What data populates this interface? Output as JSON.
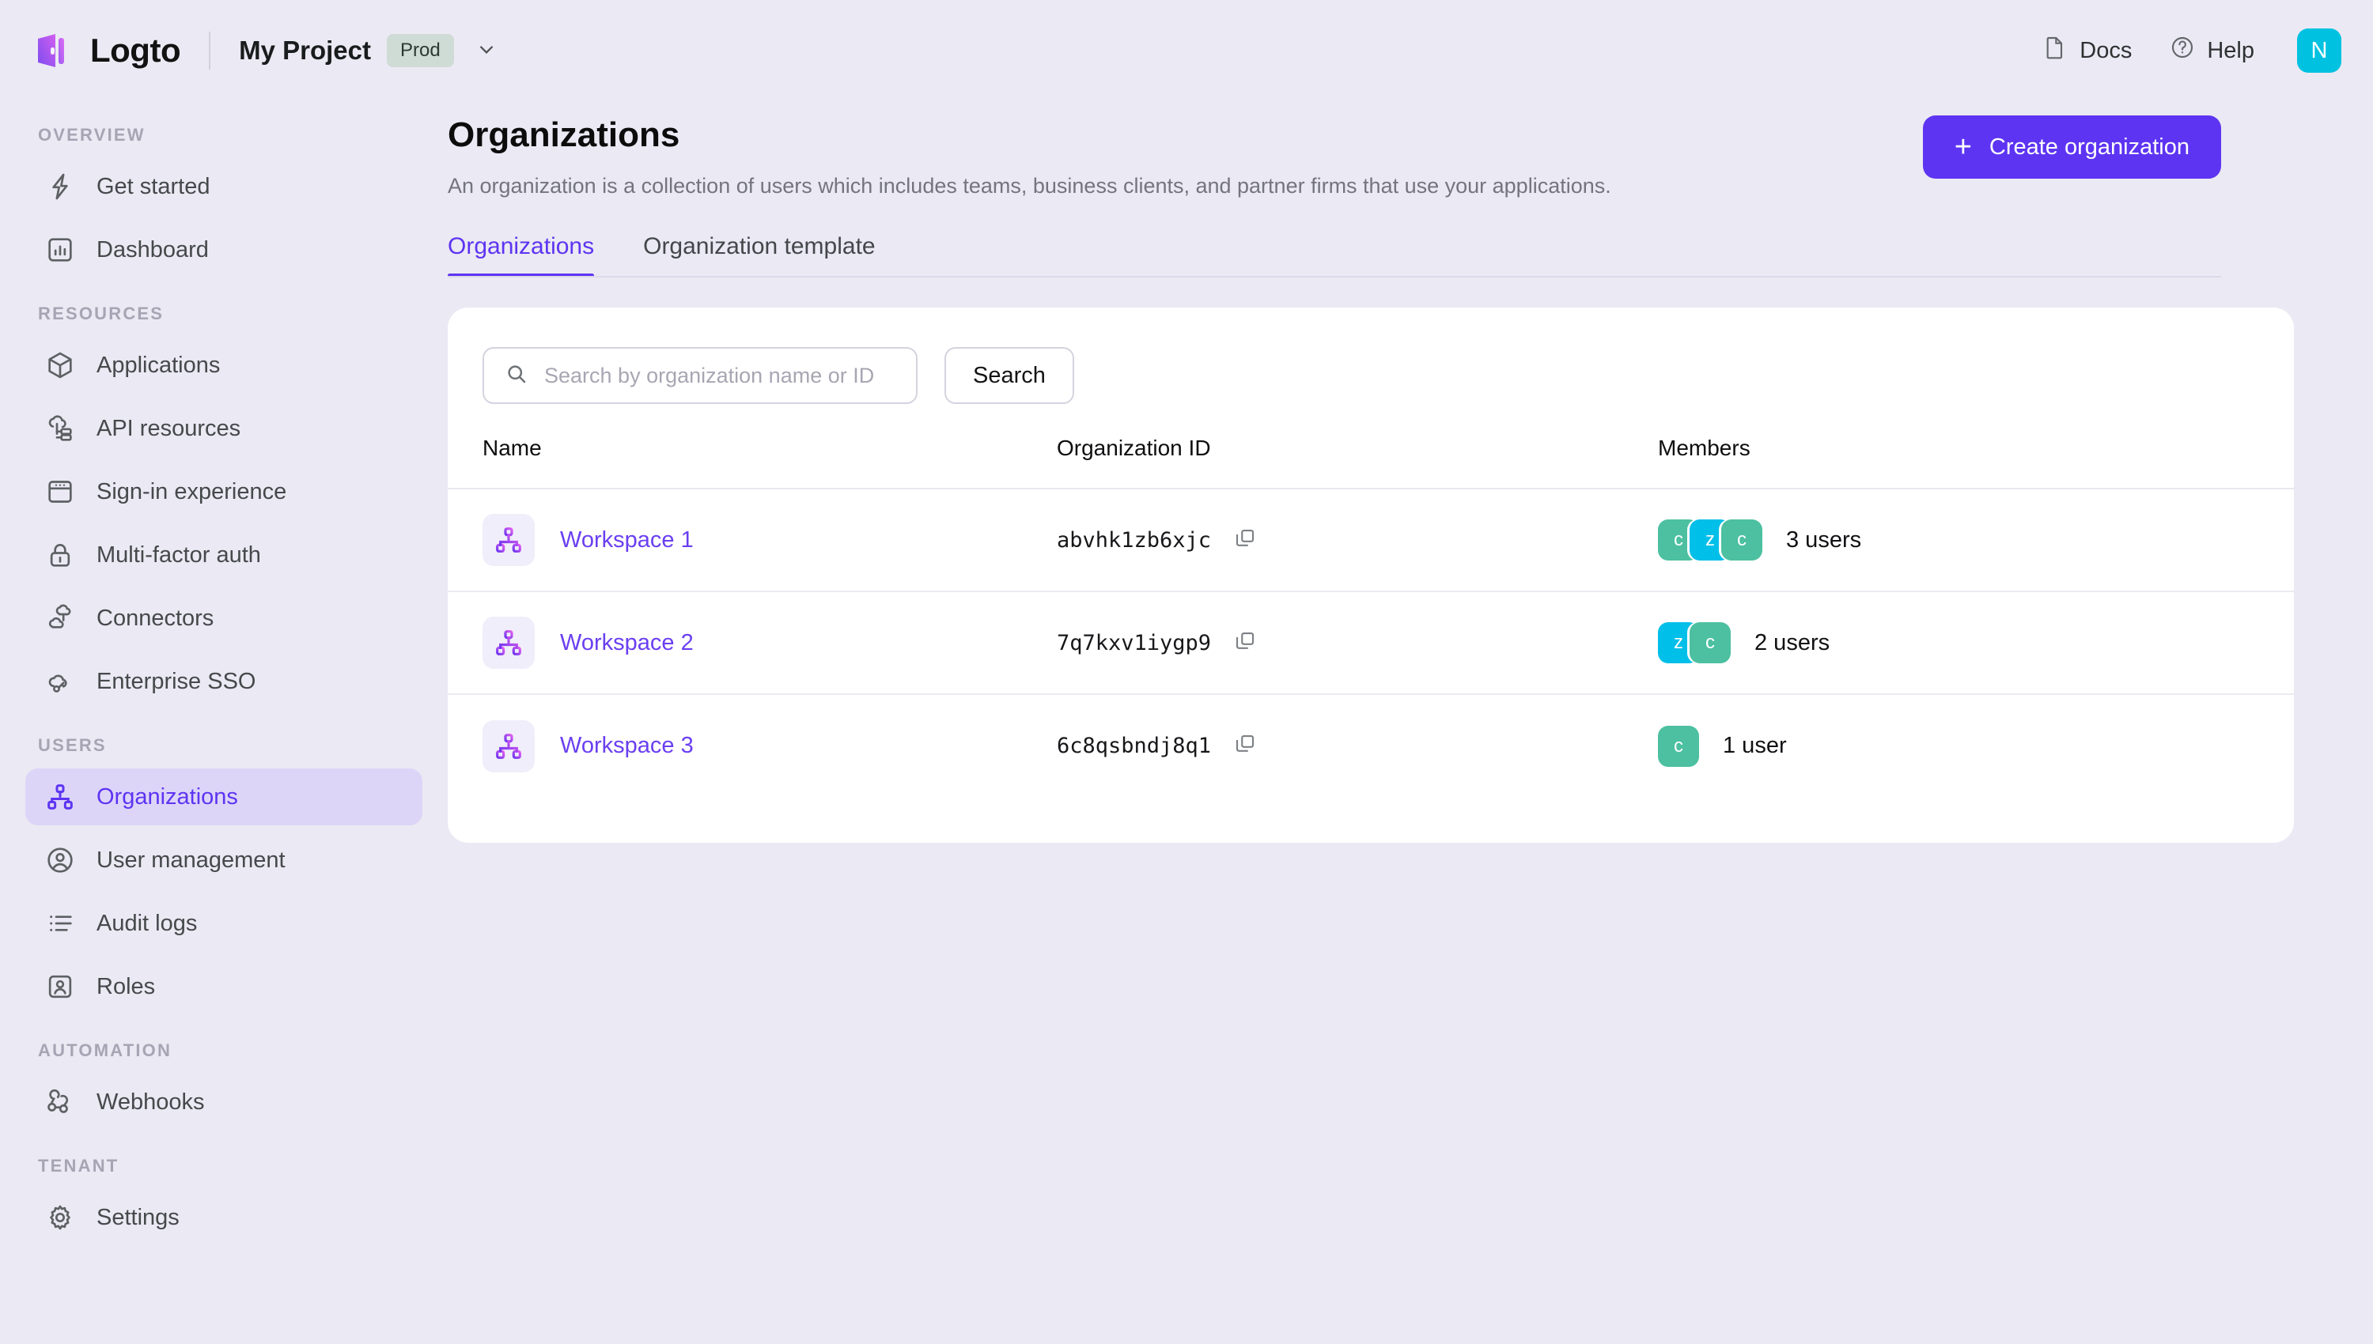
{
  "brand": {
    "name": "Logto",
    "logo_icon": "logto-logo-icon"
  },
  "project": {
    "name": "My Project",
    "badge": "Prod",
    "chevron_icon": "chevron-down-icon"
  },
  "topbar": {
    "docs_label": "Docs",
    "docs_icon": "document-icon",
    "help_label": "Help",
    "help_icon": "question-circle-icon",
    "avatar_initial": "N",
    "avatar_color": "#00c2e0"
  },
  "sidebar": {
    "sections": [
      {
        "title": "OVERVIEW",
        "items": [
          {
            "label": "Get started",
            "icon": "lightning-bolt-icon",
            "active": false
          },
          {
            "label": "Dashboard",
            "icon": "bar-chart-icon",
            "active": false
          }
        ]
      },
      {
        "title": "RESOURCES",
        "items": [
          {
            "label": "Applications",
            "icon": "cube-icon",
            "active": false
          },
          {
            "label": "API resources",
            "icon": "api-cloud-icon",
            "active": false
          },
          {
            "label": "Sign-in experience",
            "icon": "browser-window-icon",
            "active": false
          },
          {
            "label": "Multi-factor auth",
            "icon": "lock-icon",
            "active": false
          },
          {
            "label": "Connectors",
            "icon": "connectors-icon",
            "active": false
          },
          {
            "label": "Enterprise SSO",
            "icon": "cloud-key-icon",
            "active": false
          }
        ]
      },
      {
        "title": "USERS",
        "items": [
          {
            "label": "Organizations",
            "icon": "organization-icon",
            "active": true
          },
          {
            "label": "User management",
            "icon": "user-circle-icon",
            "active": false
          },
          {
            "label": "Audit logs",
            "icon": "list-icon",
            "active": false
          },
          {
            "label": "Roles",
            "icon": "id-badge-icon",
            "active": false
          }
        ]
      },
      {
        "title": "AUTOMATION",
        "items": [
          {
            "label": "Webhooks",
            "icon": "webhook-icon",
            "active": false
          }
        ]
      },
      {
        "title": "TENANT",
        "items": [
          {
            "label": "Settings",
            "icon": "gear-icon",
            "active": false
          }
        ]
      }
    ]
  },
  "page": {
    "title": "Organizations",
    "subtitle": "An organization is a collection of users which includes teams, business clients, and partner firms that use your applications.",
    "create_button": {
      "label": "Create organization",
      "icon": "plus-icon",
      "color": "#5d34f2"
    }
  },
  "tabs": [
    {
      "label": "Organizations",
      "active": true
    },
    {
      "label": "Organization template",
      "active": false
    }
  ],
  "search": {
    "placeholder": "Search by organization name or ID",
    "value": "",
    "icon": "search-icon",
    "button_label": "Search"
  },
  "table": {
    "columns": [
      "Name",
      "Organization ID",
      "Members"
    ],
    "rows": [
      {
        "name": "Workspace 1",
        "icon": "organization-tile-icon",
        "id": "abvhk1zb6xjc",
        "copy_icon": "copy-icon",
        "members_count": "3 users",
        "avatars": [
          {
            "initial": "c",
            "color": "#4cc0a0"
          },
          {
            "initial": "z",
            "color": "#00bfe8"
          },
          {
            "initial": "c",
            "color": "#4cc0a0"
          }
        ]
      },
      {
        "name": "Workspace 2",
        "icon": "organization-tile-icon",
        "id": "7q7kxv1iygp9",
        "copy_icon": "copy-icon",
        "members_count": "2 users",
        "avatars": [
          {
            "initial": "z",
            "color": "#00bfe8"
          },
          {
            "initial": "c",
            "color": "#4cc0a0"
          }
        ]
      },
      {
        "name": "Workspace 3",
        "icon": "organization-tile-icon",
        "id": "6c8qsbndj8q1",
        "copy_icon": "copy-icon",
        "members_count": "1 user",
        "avatars": [
          {
            "initial": "c",
            "color": "#4cc0a0"
          }
        ]
      }
    ]
  },
  "colors": {
    "page_bg": "#ebe9f3",
    "accent": "#5d34f2",
    "card_bg": "#ffffff",
    "active_nav_bg": "#ddd5f8"
  }
}
